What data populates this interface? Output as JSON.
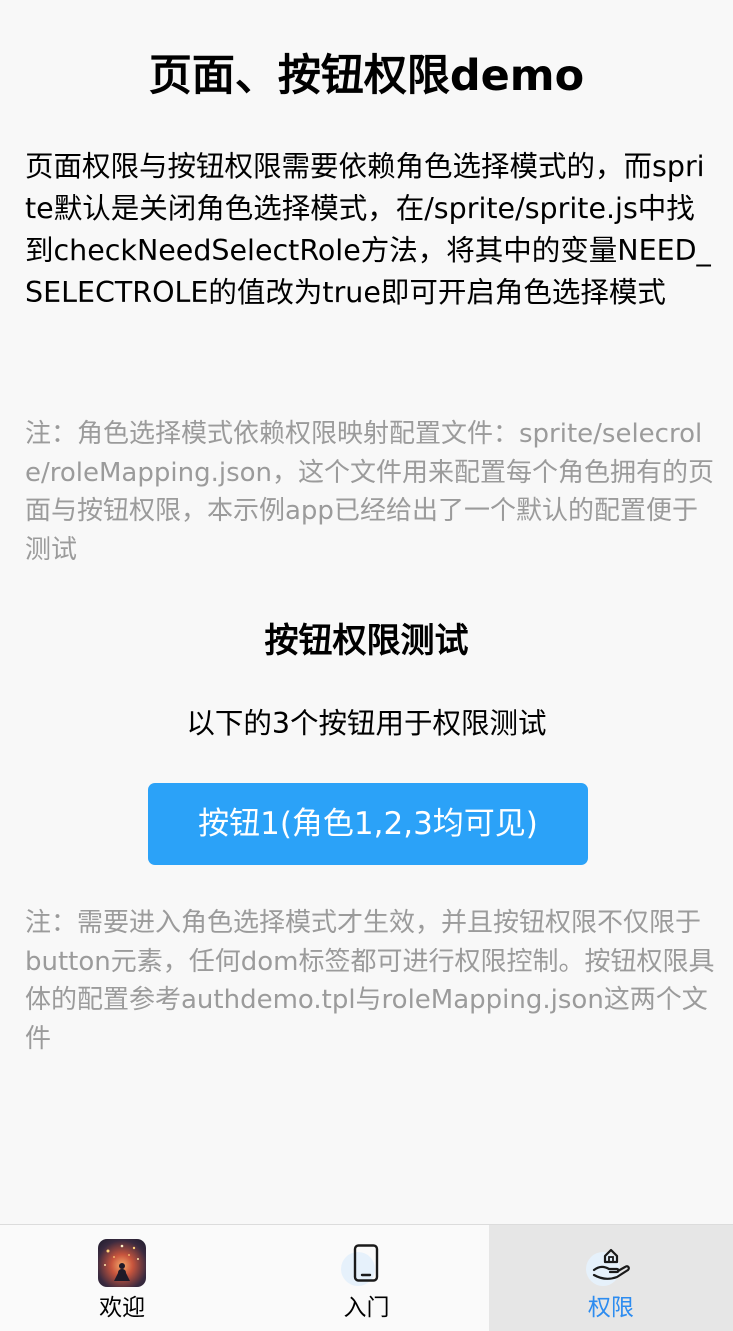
{
  "page": {
    "title": "页面、按钮权限demo",
    "intro": "页面权限与按钮权限需要依赖角色选择模式的，而sprite默认是关闭角色选择模式，在/sprite/sprite.js中找到checkNeedSelectRole方法，将其中的变量NEED_SELECTROLE的值改为true即可开启角色选择模式",
    "note_mapping": "注：角色选择模式依赖权限映射配置文件：sprite/selecrole/roleMapping.json，这个文件用来配置每个角色拥有的页面与按钮权限，本示例app已经给出了一个默认的配置便于测试",
    "section_title": "按钮权限测试",
    "section_sub": "以下的3个按钮用于权限测试",
    "button_label": "按钮1(角色1,2,3均可见)",
    "note_button": "注：需要进入角色选择模式才生效，并且按钮权限不仅限于button元素，任何dom标签都可进行权限控制。按钮权限具体的配置参考authdemo.tpl与roleMapping.json这两个文件"
  },
  "tabbar": {
    "tabs": [
      {
        "label": "欢迎",
        "icon": "avatar-image"
      },
      {
        "label": "入门",
        "icon": "phone-icon"
      },
      {
        "label": "权限",
        "icon": "hand-house-icon",
        "active": true
      }
    ]
  },
  "colors": {
    "accent": "#2ba2f8",
    "active_tab_text": "#2d8cf0",
    "note_text": "#9b9b9b",
    "active_tab_bg": "#e6e6e6"
  }
}
